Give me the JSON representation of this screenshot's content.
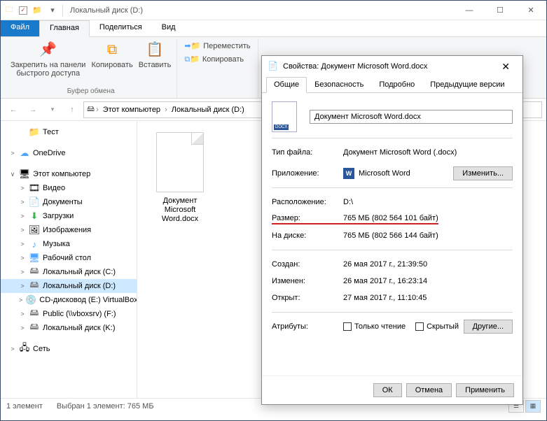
{
  "titlebar": {
    "title": "Локальный диск (D:)"
  },
  "ribbonTabs": {
    "file": "Файл",
    "home": "Главная",
    "share": "Поделиться",
    "view": "Вид"
  },
  "ribbon": {
    "pin": "Закрепить на панели\nбыстрого доступа",
    "copy": "Копировать",
    "paste": "Вставить",
    "group1": "Буфер обмена",
    "move": "Переместить",
    "copyTo": "Копировать"
  },
  "breadcrumb": {
    "pc": "Этот компьютер",
    "drive": "Локальный диск (D:)"
  },
  "tree": {
    "items": [
      {
        "icon": "📁",
        "cls": "c-folder",
        "label": "Тест",
        "indent": 1
      },
      {
        "icon": "☁",
        "cls": "c-blue",
        "label": "OneDrive",
        "indent": 0,
        "exp": ">"
      },
      {
        "icon": "🖥",
        "cls": "",
        "label": "Этот компьютер",
        "indent": 0,
        "exp": "∨"
      },
      {
        "icon": "🎞",
        "cls": "",
        "label": "Видео",
        "indent": 1,
        "exp": ">"
      },
      {
        "icon": "📄",
        "cls": "",
        "label": "Документы",
        "indent": 1,
        "exp": ">"
      },
      {
        "icon": "⬇",
        "cls": "c-green",
        "label": "Загрузки",
        "indent": 1,
        "exp": ">"
      },
      {
        "icon": "🖼",
        "cls": "",
        "label": "Изображения",
        "indent": 1,
        "exp": ">"
      },
      {
        "icon": "♪",
        "cls": "c-blue",
        "label": "Музыка",
        "indent": 1,
        "exp": ">"
      },
      {
        "icon": "🖥",
        "cls": "c-blue",
        "label": "Рабочий стол",
        "indent": 1,
        "exp": ">"
      },
      {
        "icon": "🖴",
        "cls": "c-drive",
        "label": "Локальный диск (C:)",
        "indent": 1,
        "exp": ">"
      },
      {
        "icon": "🖴",
        "cls": "c-drive",
        "label": "Локальный диск (D:)",
        "indent": 1,
        "exp": ">",
        "selected": true
      },
      {
        "icon": "💿",
        "cls": "",
        "label": "CD-дисковод (E:) VirtualBox G",
        "indent": 1,
        "exp": ">"
      },
      {
        "icon": "🖴",
        "cls": "c-drive",
        "label": "Public (\\\\vboxsrv) (F:)",
        "indent": 1,
        "exp": ">"
      },
      {
        "icon": "🖴",
        "cls": "c-drive",
        "label": "Локальный диск (K:)",
        "indent": 1,
        "exp": ">"
      },
      {
        "icon": "🖧",
        "cls": "",
        "label": "Сеть",
        "indent": 0,
        "exp": ">"
      }
    ]
  },
  "file": {
    "name": "Документ Microsoft Word.docx"
  },
  "statusbar": {
    "count": "1 элемент",
    "selected": "Выбран 1 элемент: 765 МБ"
  },
  "dialog": {
    "title": "Свойства: Документ Microsoft Word.docx",
    "tabs": {
      "general": "Общие",
      "security": "Безопасность",
      "details": "Подробно",
      "prev": "Предыдущие версии"
    },
    "filename": "Документ Microsoft Word.docx",
    "rows": {
      "typeKey": "Тип файла:",
      "typeVal": "Документ Microsoft Word (.docx)",
      "appKey": "Приложение:",
      "appVal": "Microsoft Word",
      "changeBtn": "Изменить...",
      "locKey": "Расположение:",
      "locVal": "D:\\",
      "sizeKey": "Размер:",
      "sizeVal": "765 МБ (802 564 101 байт)",
      "diskKey": "На диске:",
      "diskVal": "765 МБ (802 566 144 байт)",
      "createdKey": "Создан:",
      "createdVal": "26 мая 2017 г., 21:39:50",
      "modifiedKey": "Изменен:",
      "modifiedVal": "26 мая 2017 г., 16:23:14",
      "openedKey": "Открыт:",
      "openedVal": "27 мая 2017 г., 11:10:45",
      "attrKey": "Атрибуты:",
      "readonly": "Только чтение",
      "hidden": "Скрытый",
      "otherBtn": "Другие..."
    },
    "footer": {
      "ok": "ОК",
      "cancel": "Отмена",
      "apply": "Применить"
    }
  }
}
